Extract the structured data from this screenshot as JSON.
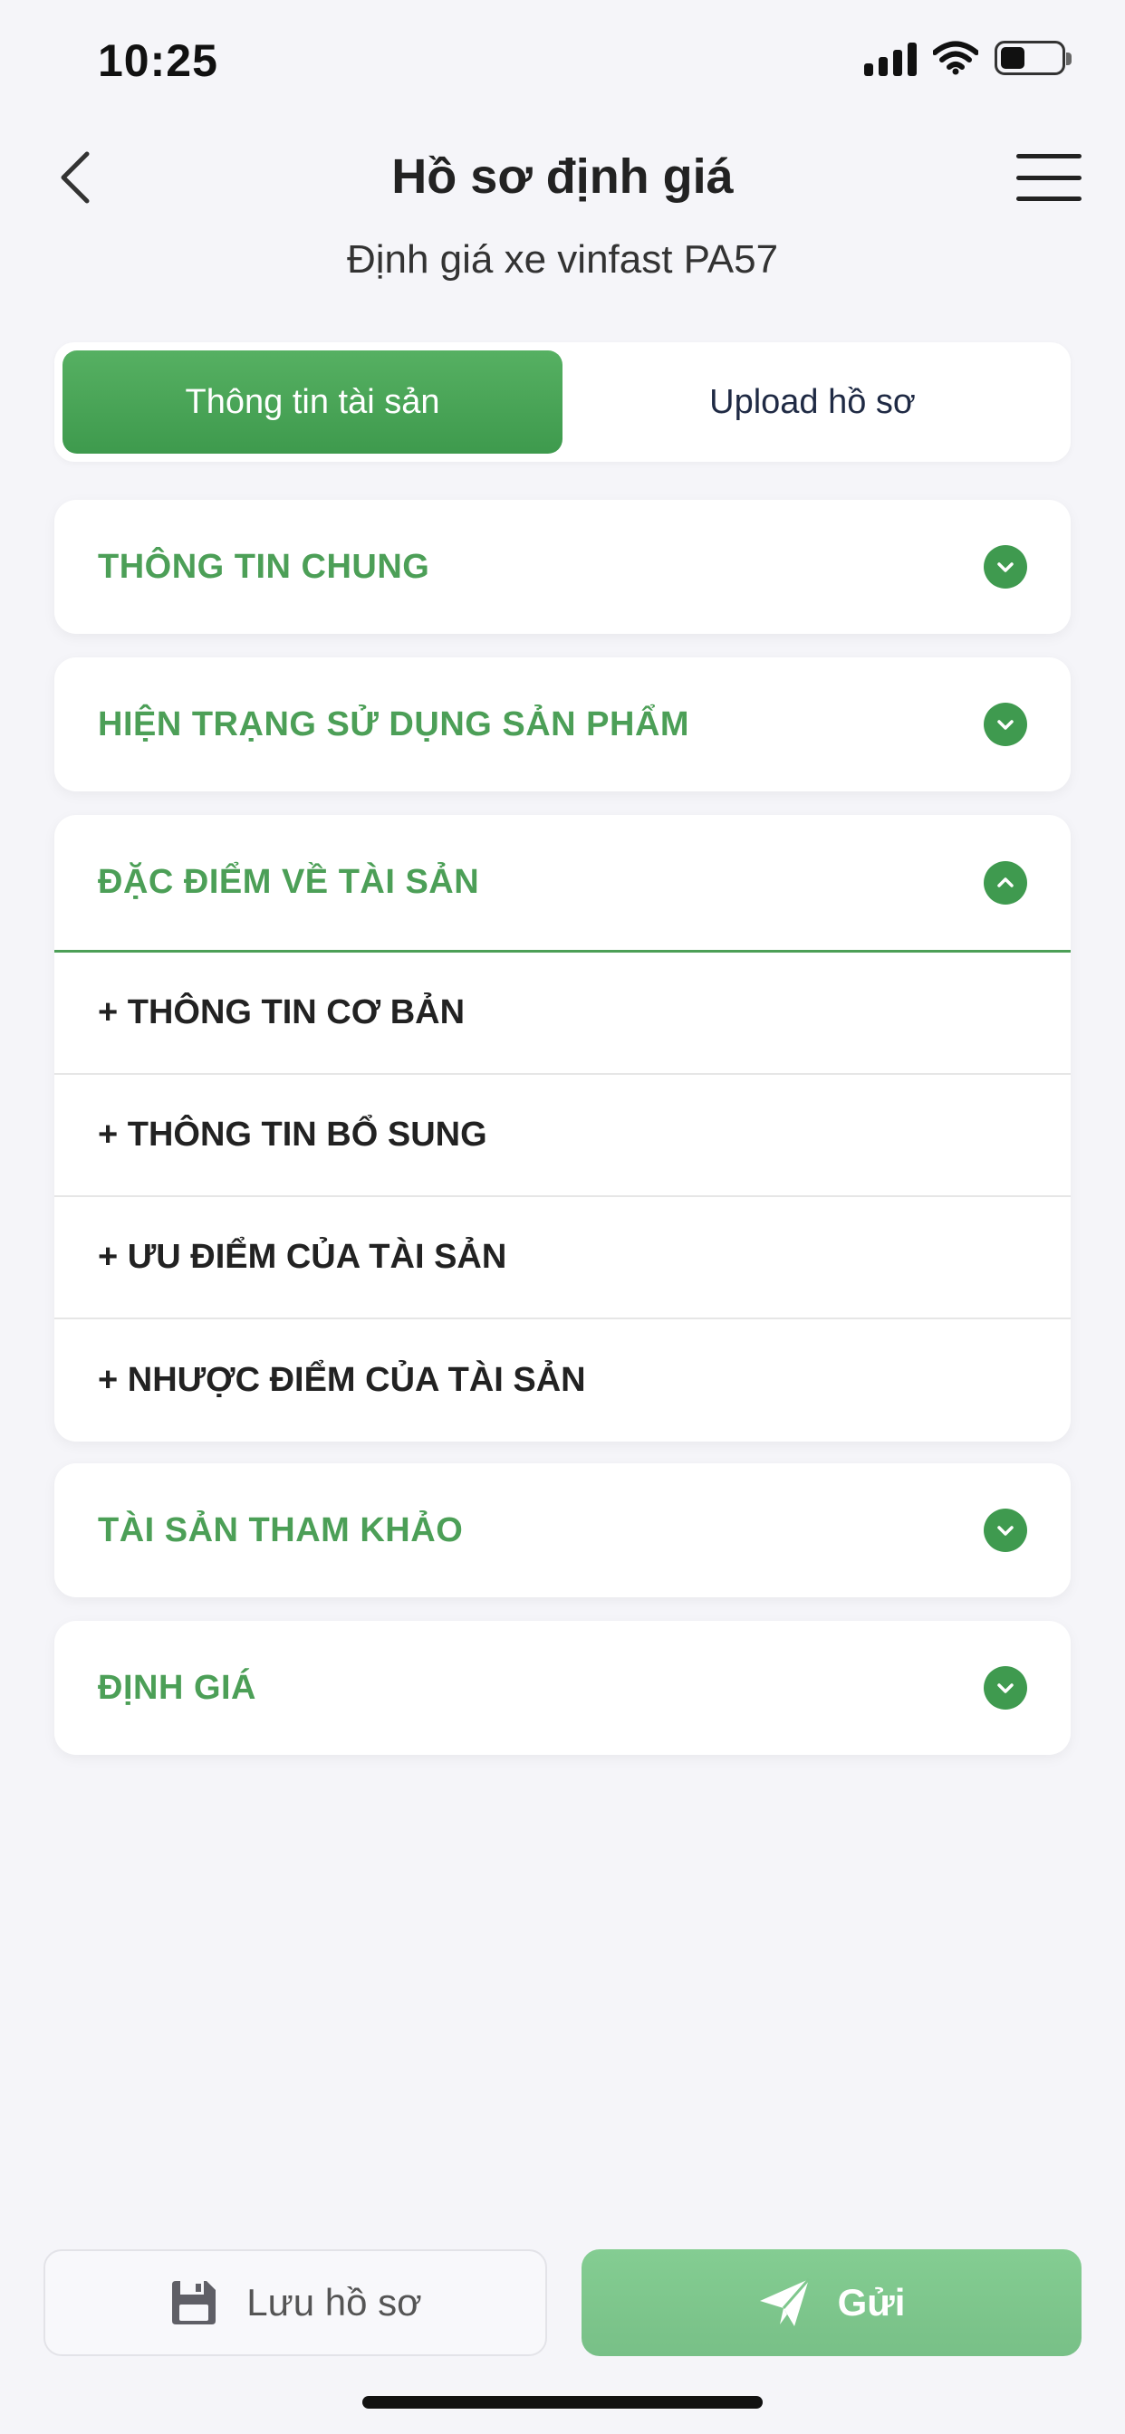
{
  "status_bar": {
    "time": "10:25",
    "icons": [
      "signal-icon",
      "wifi-icon",
      "battery-icon"
    ],
    "battery_level": 0.35
  },
  "header": {
    "title": "Hồ sơ định giá",
    "subtitle": "Định giá xe vinfast PA57",
    "icons": [
      "back-chevron-icon",
      "hamburger-menu-icon"
    ]
  },
  "tabs": [
    {
      "label": "Thông tin tài sản",
      "active": true
    },
    {
      "label": "Upload hồ sơ",
      "active": false
    }
  ],
  "sections": [
    {
      "title": "THÔNG TIN CHUNG",
      "expanded": false
    },
    {
      "title": "HIỆN TRẠNG SỬ DỤNG SẢN PHẨM",
      "expanded": false
    },
    {
      "title": "ĐẶC ĐIỂM VỀ TÀI SẢN",
      "expanded": true,
      "items": [
        "+ THÔNG TIN CƠ BẢN",
        "+ THÔNG TIN BỔ SUNG",
        "+ ƯU ĐIỂM CỦA TÀI SẢN",
        "+ NHƯỢC ĐIỂM CỦA TÀI SẢN"
      ]
    },
    {
      "title": "TÀI SẢN THAM KHẢO",
      "expanded": false
    },
    {
      "title": "ĐỊNH GIÁ",
      "expanded": false
    }
  ],
  "actions": {
    "save_label": "Lưu hồ sơ",
    "send_label": "Gửi",
    "save_icon": "floppy-disk-icon",
    "send_icon": "paper-plane-icon"
  },
  "colors": {
    "accent": "#4c9f57",
    "active_tab": "#4aa659",
    "send_button": "#7fc78d",
    "background": "#f5f5f9"
  }
}
